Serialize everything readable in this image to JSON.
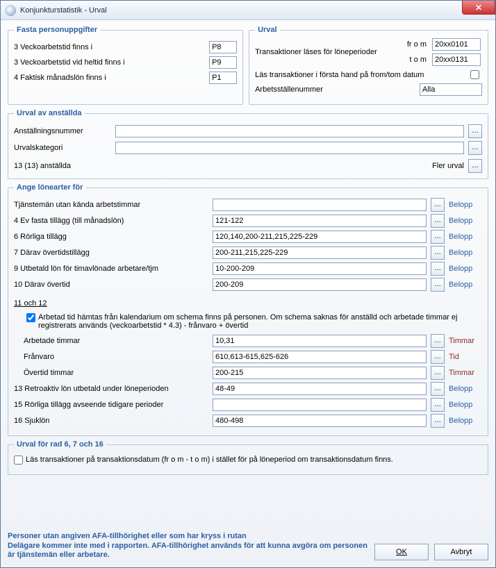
{
  "window": {
    "title": "Konjunkturstatistik - Urval"
  },
  "fasta": {
    "legend": "Fasta personuppgifter",
    "r1": {
      "label": "3 Veckoarbetstid finns i",
      "value": "P8"
    },
    "r2": {
      "label": "3 Veckoarbetstid vid heltid finns i",
      "value": "P9"
    },
    "r3": {
      "label": "4 Faktisk månadslön finns i",
      "value": "P1"
    }
  },
  "urval": {
    "legend": "Urval",
    "trans_label": "Transaktioner läses för löneperioder",
    "from_label": "fr o m",
    "from_value": "20xx0101",
    "to_label": "t o m",
    "to_value": "20xx0131",
    "check_label": "Läs transaktioner i första hand på from/tom datum",
    "arbsts_label": "Arbetsställenummer",
    "arbsts_value": "Alla"
  },
  "anst": {
    "legend": "Urval av anställda",
    "nr_label": "Anställningsnummer",
    "nr_value": "",
    "kat_label": "Urvalskategori",
    "kat_value": "",
    "count": "13 (13) anställda",
    "fler": "Fler urval"
  },
  "lonearter": {
    "legend": "Ange lönearter för",
    "unit_belopp": "Belopp",
    "unit_timmar": "Timmar",
    "unit_tid": "Tid",
    "rows": [
      {
        "label": "Tjänstemän utan kända arbetstimmar",
        "value": "",
        "unit": "Belopp"
      },
      {
        "label": "4 Ev fasta tillägg (till månadslön)",
        "value": "121-122",
        "unit": "Belopp"
      },
      {
        "label": "6 Rörliga tillägg",
        "value": "120,140,200-211,215,225-229",
        "unit": "Belopp"
      },
      {
        "label": "7 Därav övertidstillägg",
        "value": "200-211,215,225-229",
        "unit": "Belopp"
      },
      {
        "label": "9 Utbetald lön för timavlönade arbetare/tjm",
        "value": "10-200-209",
        "unit": "Belopp"
      },
      {
        "label": "10 Därav övertid",
        "value": "200-209",
        "unit": "Belopp"
      }
    ],
    "subhead": "11 och 12",
    "check11_label": "Arbetad tid hämtas från kalendarium om schema finns på personen. Om schema saknas för anställd och arbetade timmar ej registrerats används (veckoarbetstid * 4.3) - frånvaro + övertid",
    "rows2": [
      {
        "label": "Arbetade timmar",
        "value": "10,31",
        "unit": "Timmar",
        "indent": true,
        "red": true
      },
      {
        "label": "Frånvaro",
        "value": "610,613-615,625-626",
        "unit": "Tid",
        "indent": true,
        "red": true
      },
      {
        "label": "Övertid timmar",
        "value": "200-215",
        "unit": "Timmar",
        "indent": true,
        "red": true
      },
      {
        "label": "13 Retroaktiv lön utbetald under löneperioden",
        "value": "48-49",
        "unit": "Belopp"
      },
      {
        "label": "15 Rörliga tillägg avseende tidigare perioder",
        "value": "",
        "unit": "Belopp"
      },
      {
        "label": "16 Sjuklön",
        "value": "480-498",
        "unit": "Belopp"
      }
    ]
  },
  "urval6716": {
    "legend": "Urval för rad 6, 7 och 16",
    "check_label": "Läs transaktioner på transaktionsdatum (fr o m - t o m)  i stället för på löneperiod om transaktionsdatum finns."
  },
  "footer": {
    "text1": "Personer utan angiven AFA-tillhörighet eller som har kryss i rutan",
    "text2": "Delägare kommer inte med i rapporten. AFA-tillhörighet används för att kunna avgöra om personen är tjänstemän eller arbetare.",
    "ok": "OK",
    "cancel": "Avbryt"
  }
}
